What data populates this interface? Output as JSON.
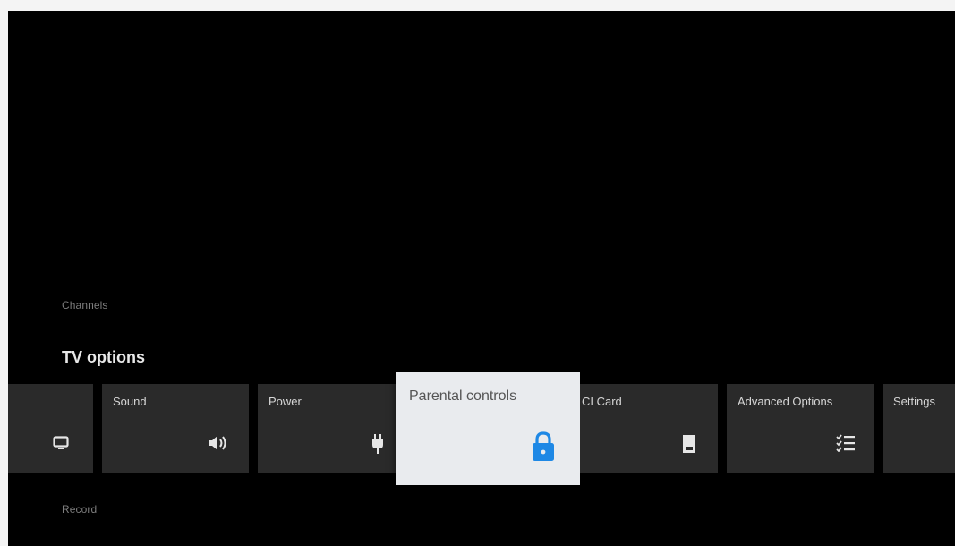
{
  "sections": {
    "above": "Channels",
    "current": "TV options",
    "below": "Record"
  },
  "cards": [
    {
      "label": "",
      "icon": "tv-screen-icon"
    },
    {
      "label": "Sound",
      "icon": "speaker-volume-icon"
    },
    {
      "label": "Power",
      "icon": "power-plug-icon"
    },
    {
      "label": "Parental controls",
      "icon": "lock-icon",
      "focused": true
    },
    {
      "label": "CI Card",
      "icon": "sd-card-icon"
    },
    {
      "label": "Advanced Options",
      "icon": "checklist-icon"
    },
    {
      "label": "Settings",
      "icon": ""
    }
  ],
  "colors": {
    "background": "#000000",
    "card": "#2a2a2a",
    "focused_card": "#e9ebee",
    "lock_accent": "#1e88e5"
  }
}
